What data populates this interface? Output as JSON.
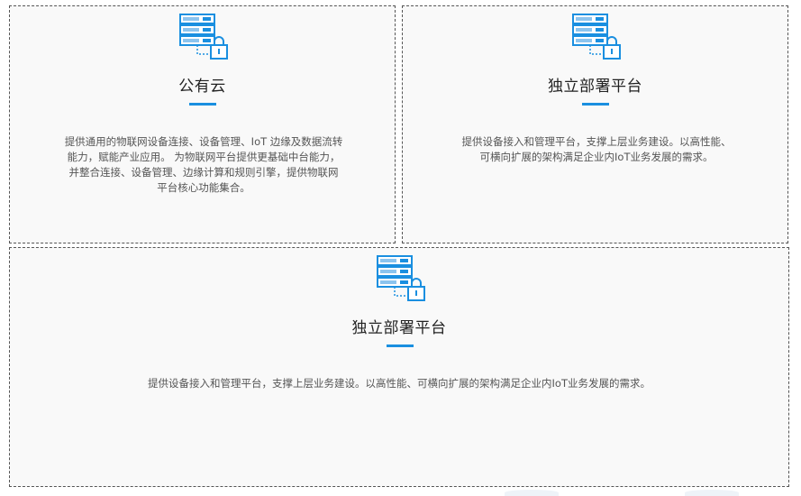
{
  "cards": [
    {
      "icon": "server-lock-icon",
      "title": "公有云",
      "description": "提供通用的物联网设备连接、设备管理、IoT 边缘及数据流转能力，赋能产业应用。 为物联网平台提供更基础中台能力，并整合连接、设备管理、边缘计算和规则引擎，提供物联网平台核心功能集合。"
    },
    {
      "icon": "server-lock-icon",
      "title": "独立部署平台",
      "description": "提供设备接入和管理平台，支撑上层业务建设。以高性能、可横向扩展的架构满足企业内IoT业务发展的需求。"
    },
    {
      "icon": "server-lock-icon",
      "title": "独立部署平台",
      "description": "提供设备接入和管理平台，支撑上层业务建设。以高性能、可横向扩展的架构满足企业内IoT业务发展的需求。"
    }
  ],
  "colors": {
    "accent": "#1a8fe0",
    "border": "#555555",
    "card_bg": "#f9f9f9"
  }
}
